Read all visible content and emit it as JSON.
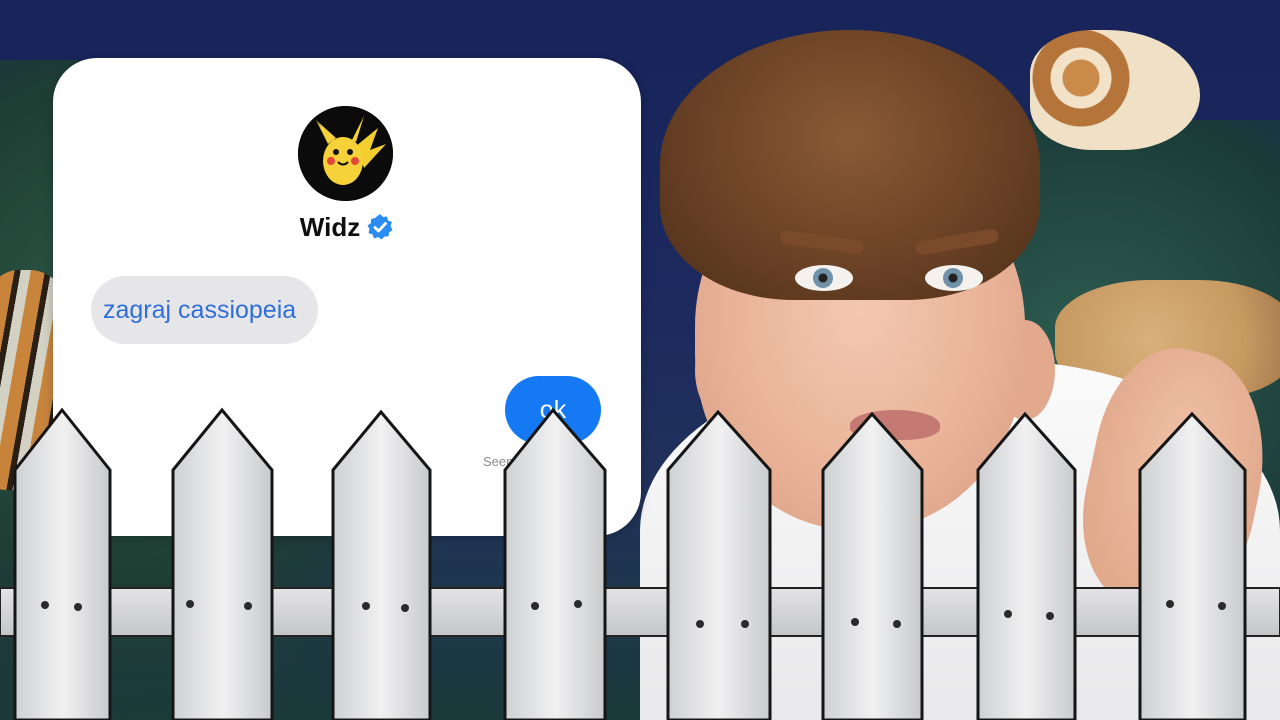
{
  "chat": {
    "contact_name": "Widz",
    "verified": true,
    "avatar_icon": "pikachu-icon",
    "incoming_message": "zagraj cassiopeia",
    "outgoing_message": "ok",
    "status": "Seen"
  },
  "colors": {
    "bubble_blue": "#1479f2",
    "incoming_text": "#2f6fd9",
    "incoming_bubble": "#e6e6e8",
    "verified_blue": "#2a8cf0",
    "fence_white": "#e9e9ea"
  }
}
